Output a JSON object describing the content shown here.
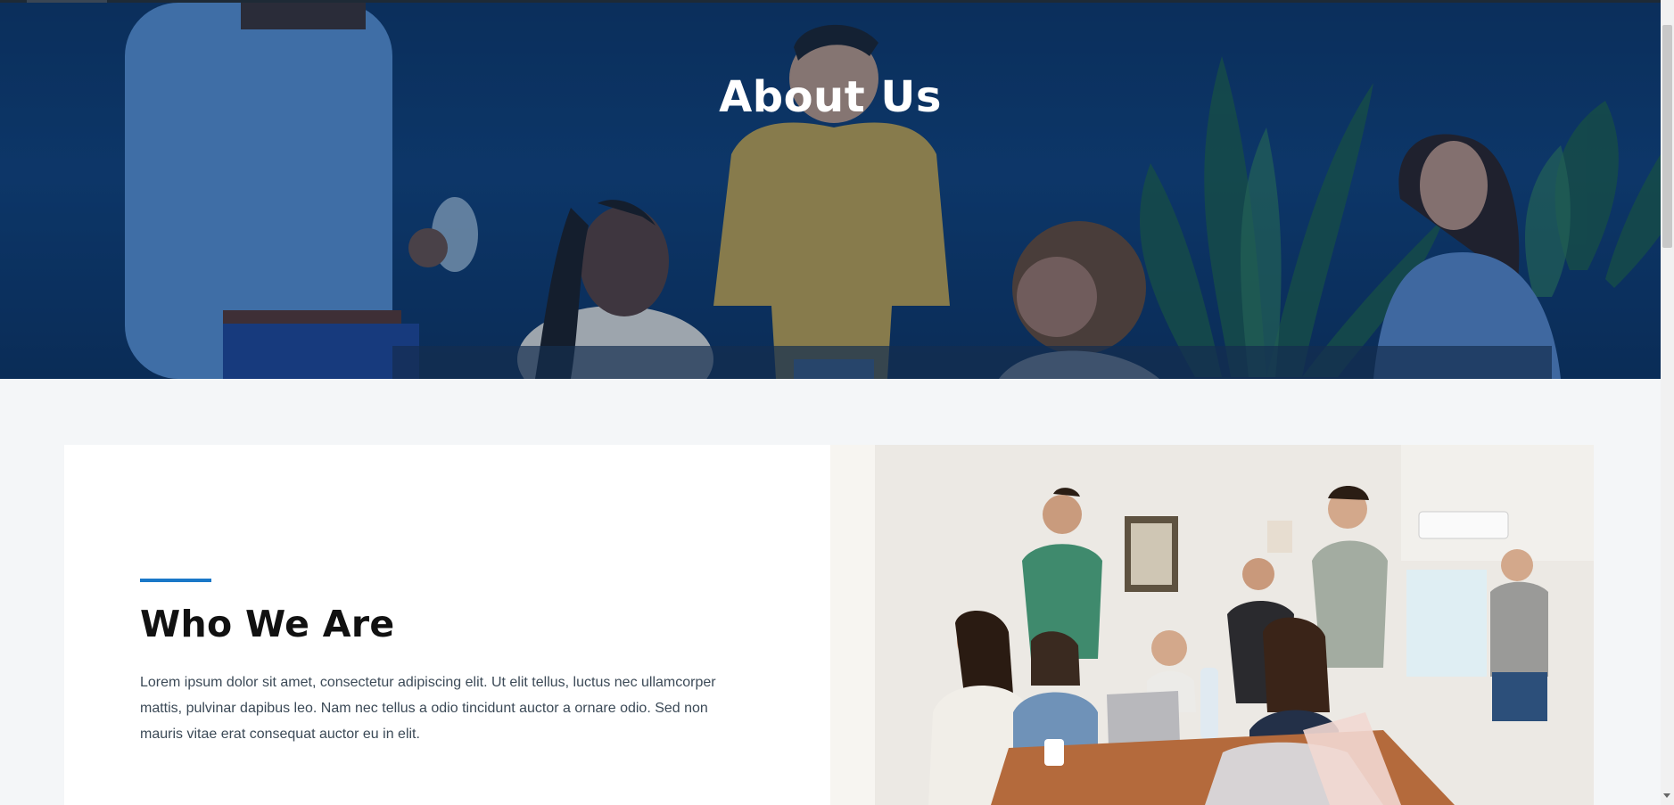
{
  "hero": {
    "title": "About Us",
    "image_description_icon": "hero-team-photo"
  },
  "who_we_are": {
    "heading": "Who We Are",
    "body": "Lorem ipsum dolor sit amet, consectetur adipiscing elit. Ut elit tellus, luctus nec ullamcorper mattis, pulvinar dapibus leo. Nam nec tellus a odio tincidunt auctor a ornare odio. Sed non mauris vitae erat consequat auctor eu in elit.",
    "image_icon": "team-meeting-photo"
  },
  "colors": {
    "accent": "#1a78c8",
    "hero_overlay": "#0e3a6b",
    "page_background": "#f4f6f8",
    "card_background": "#ffffff"
  }
}
